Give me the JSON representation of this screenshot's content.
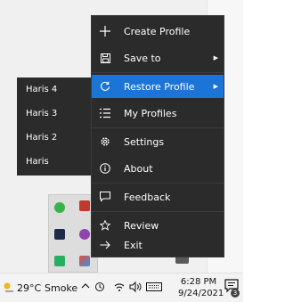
{
  "context_menu": {
    "items": [
      {
        "label": "Create Profile",
        "icon": "plus-icon"
      },
      {
        "label": "Save to",
        "icon": "save-icon",
        "has_submenu": true
      },
      {
        "label": "Restore Profile",
        "icon": "restore-icon",
        "has_submenu": true,
        "highlighted": true
      },
      {
        "label": "My Profiles",
        "icon": "list-icon"
      },
      {
        "label": "Settings",
        "icon": "gear-icon"
      },
      {
        "label": "About",
        "icon": "info-icon"
      },
      {
        "label": "Feedback",
        "icon": "feedback-icon"
      },
      {
        "label": "Review",
        "icon": "star-icon"
      },
      {
        "label": "Exit",
        "icon": "exit-arrow-icon"
      }
    ]
  },
  "submenu": {
    "items": [
      {
        "label": "Haris 4"
      },
      {
        "label": "Haris 3"
      },
      {
        "label": "Haris 2"
      },
      {
        "label": "Haris"
      }
    ]
  },
  "taskbar": {
    "weather_temp": "29°C",
    "weather_desc": "Smoke",
    "time": "6:28 PM",
    "date": "9/24/2021",
    "notification_count": "3"
  },
  "colors": {
    "menu_bg": "#2b2b2b",
    "highlight": "#1b74d6"
  }
}
